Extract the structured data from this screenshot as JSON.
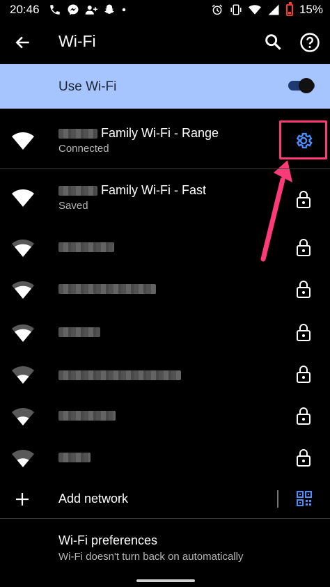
{
  "status_bar": {
    "time": "20:46",
    "battery_percent": "15%",
    "battery_color": "#ff3b30"
  },
  "app_bar": {
    "title": "Wi-Fi",
    "back_icon": "arrow-left-icon",
    "search_icon": "search-icon",
    "help_icon": "help-circle-icon"
  },
  "use_wifi": {
    "label": "Use Wi-Fi",
    "enabled": true,
    "background": "#a6c5ff"
  },
  "connected_network": {
    "name": "Family Wi-Fi - Range",
    "status": "Connected",
    "settings_icon": "gear-icon",
    "accent": "#4f8dff",
    "highlight_color": "#ff3a79"
  },
  "networks": [
    {
      "name": "Family Wi-Fi - Fast",
      "status": "Saved"
    },
    {
      "name": "",
      "status": ""
    },
    {
      "name": "",
      "status": ""
    },
    {
      "name": "",
      "status": ""
    },
    {
      "name": "",
      "status": ""
    },
    {
      "name": "",
      "status": ""
    },
    {
      "name": "",
      "status": ""
    }
  ],
  "add_network": {
    "label": "Add network",
    "qr_icon": "qr-code-scanner-icon"
  },
  "preferences": {
    "title": "Wi-Fi preferences",
    "subtitle": "Wi-Fi doesn't turn back on automatically"
  }
}
